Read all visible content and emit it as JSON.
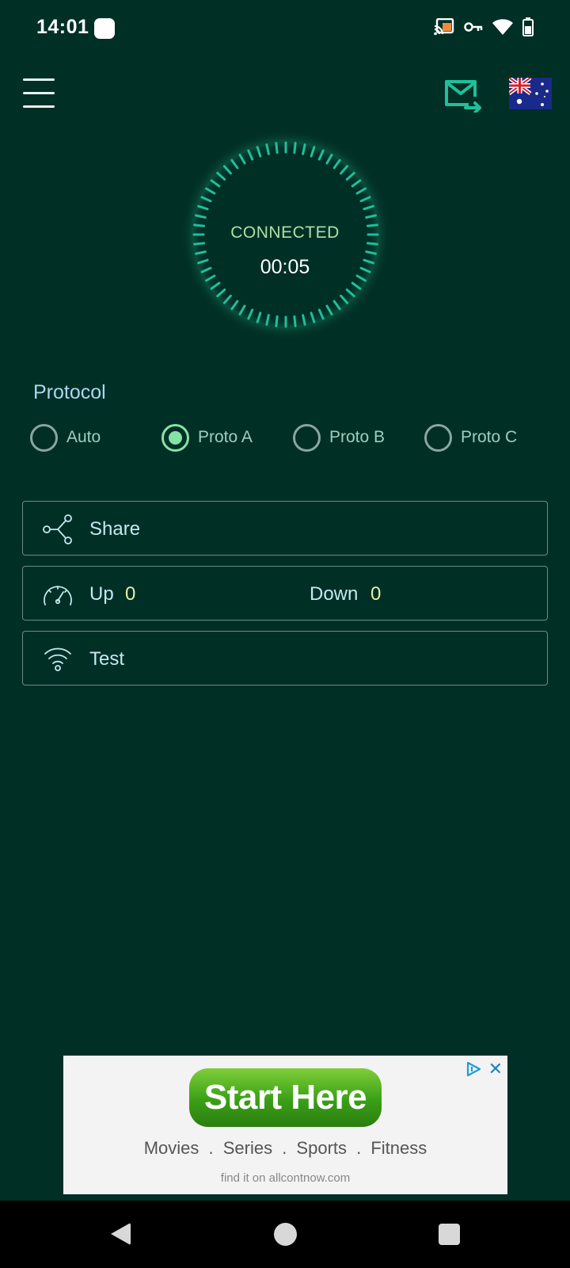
{
  "status_bar": {
    "time": "14:01",
    "icons": [
      "cast-icon",
      "vpn-key-icon",
      "wifi-icon",
      "battery-icon"
    ]
  },
  "header": {
    "menu_icon": "hamburger-icon",
    "feedback_icon": "mail-forward-icon",
    "server_flag": "australia-flag-icon"
  },
  "connection": {
    "status": "CONNECTED",
    "timer": "00:05"
  },
  "protocol": {
    "label": "Protocol",
    "options": [
      {
        "label": "Auto",
        "selected": false
      },
      {
        "label": "Proto A",
        "selected": true
      },
      {
        "label": "Proto B",
        "selected": false
      },
      {
        "label": "Proto C",
        "selected": false
      }
    ]
  },
  "cards": {
    "share_label": "Share",
    "up_label": "Up",
    "up_value": "0",
    "down_label": "Down",
    "down_value": "0",
    "test_label": "Test"
  },
  "ad": {
    "cta": "Start Here",
    "categories": "Movies . Series . Sports . Fitness",
    "url_text": "find it on allcontnow.com"
  },
  "colors": {
    "background": "#002f26",
    "accent": "#1fbf9a",
    "selected_radio": "#86e3a8",
    "connected_text": "#a8e3a6"
  }
}
